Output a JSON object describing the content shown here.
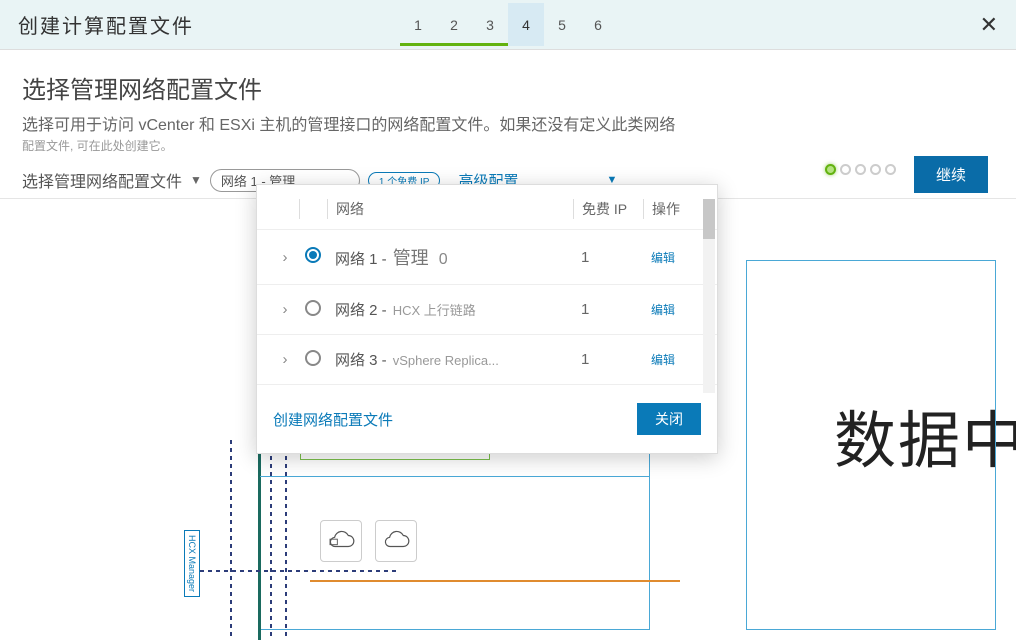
{
  "header": {
    "title": "创建计算配置文件",
    "steps": [
      "1",
      "2",
      "3",
      "4",
      "5",
      "6"
    ],
    "current_step_index": 3,
    "done_through_index": 2
  },
  "section": {
    "title": "选择管理网络配置文件",
    "desc": "选择可用于访问 vCenter 和 ESXi 主机的管理接口的网络配置文件。如果还没有定义此类网络",
    "sub": "配置文件, 可在此处创建它。"
  },
  "select": {
    "label": "选择管理网络配置文件",
    "value": "网络 1 -  管理",
    "badge": "1 个免费 IP",
    "advanced": "高级配置"
  },
  "dropdown": {
    "headers": {
      "network": "网络",
      "free_ip": "免费 IP",
      "action": "操作"
    },
    "rows": [
      {
        "selected": true,
        "label": "网络 1 -",
        "sub": "管理",
        "count": "0",
        "free_ip": "1",
        "edit": "编辑"
      },
      {
        "selected": false,
        "label": "网络 2 -",
        "sub": "HCX 上行链路",
        "count": "",
        "free_ip": "1",
        "edit": "编辑"
      },
      {
        "selected": false,
        "label": "网络 3 -",
        "sub": "vSphere Replica...",
        "count": "",
        "free_ip": "1",
        "edit": "编辑"
      }
    ],
    "create_link": "创建网络配置文件",
    "close_btn": "关闭"
  },
  "actions": {
    "continue": "继续"
  },
  "diagram": {
    "manager_label": "HCX Manager",
    "big_text": "数据中"
  },
  "colors": {
    "accent": "#0a7ab8",
    "green": "#62b20f"
  }
}
